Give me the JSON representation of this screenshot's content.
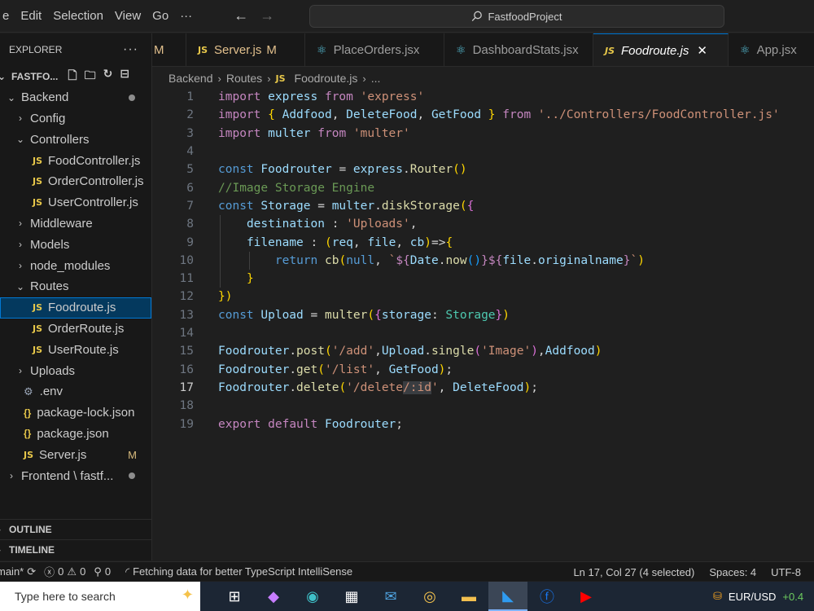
{
  "menu": {
    "items": [
      "e",
      "Edit",
      "Selection",
      "View",
      "Go",
      "···"
    ]
  },
  "nav": {
    "back": "←",
    "forward": "→"
  },
  "command_center": {
    "text": "FastfoodProject"
  },
  "explorer": {
    "title": "EXPLORER",
    "more": "···",
    "root": "FASTFO...",
    "tree": [
      {
        "label": "Backend",
        "chev": "⌄",
        "indent": 0,
        "dot": true
      },
      {
        "label": "Config",
        "chev": "›",
        "indent": 1
      },
      {
        "label": "Controllers",
        "chev": "⌄",
        "indent": 1
      },
      {
        "label": "FoodController.js",
        "badge": "JS",
        "indent": 2
      },
      {
        "label": "OrderController.js",
        "badge": "JS",
        "indent": 2
      },
      {
        "label": "UserController.js",
        "badge": "JS",
        "indent": 2
      },
      {
        "label": "Middleware",
        "chev": "›",
        "indent": 1
      },
      {
        "label": "Models",
        "chev": "›",
        "indent": 1
      },
      {
        "label": "node_modules",
        "chev": "›",
        "indent": 1
      },
      {
        "label": "Routes",
        "chev": "⌄",
        "indent": 1
      },
      {
        "label": "Foodroute.js",
        "badge": "JS",
        "indent": 2,
        "active": true
      },
      {
        "label": "OrderRoute.js",
        "badge": "JS",
        "indent": 2
      },
      {
        "label": "UserRoute.js",
        "badge": "JS",
        "indent": 2
      },
      {
        "label": "Uploads",
        "chev": "›",
        "indent": 1
      },
      {
        "label": ".env",
        "badge": "⚙",
        "indent": 1
      },
      {
        "label": "package-lock.json",
        "badge": "{}",
        "indent": 1
      },
      {
        "label": "package.json",
        "badge": "{}",
        "indent": 1
      },
      {
        "label": "Server.js",
        "badge": "JS",
        "indent": 1,
        "mod": "M"
      },
      {
        "label": "Frontend \\ fastf...",
        "chev": "›",
        "indent": 0,
        "dot": true
      }
    ],
    "outline": "OUTLINE",
    "timeline": "TIMELINE"
  },
  "tabs": [
    {
      "label": "M",
      "kind": "partial"
    },
    {
      "label": "Server.js",
      "badge": "JS",
      "mod": "M"
    },
    {
      "label": "PlaceOrders.jsx",
      "badge": "react"
    },
    {
      "label": "DashboardStats.jsx",
      "badge": "react"
    },
    {
      "label": "Foodroute.js",
      "badge": "JS",
      "active": true,
      "close": "✕"
    },
    {
      "label": "App.jsx",
      "badge": "react"
    }
  ],
  "breadcrumb": {
    "parts": [
      "Backend",
      "Routes",
      "Foodroute.js",
      "..."
    ],
    "sep": "›",
    "badge": "JS"
  },
  "editor": {
    "current_line": 17,
    "lines": [
      "import express from 'express'",
      "import { Addfood, DeleteFood, GetFood } from '../Controllers/FoodController.js'",
      "import multer from 'multer'",
      "",
      "const Foodrouter = express.Router()",
      "//Image Storage Engine",
      "const Storage = multer.diskStorage({",
      "    destination : 'Uploads',",
      "    filename : (req, file, cb)=>{",
      "        return cb(null, `${Date.now()}${file.originalname}`)",
      "    }",
      "})",
      "const Upload = multer({storage: Storage})",
      "",
      "Foodrouter.post('/add',Upload.single('Image'),Addfood)",
      "Foodrouter.get('/list', GetFood);",
      "Foodrouter.delete('/delete/:id', DeleteFood);",
      "",
      "export default Foodrouter;"
    ]
  },
  "statusbar": {
    "branch": "main*",
    "sync_icon": "⟳",
    "errors": "0",
    "warnings": "0",
    "ports": "0",
    "message": "Fetching data for better TypeScript IntelliSense",
    "cursor": "Ln 17, Col 27 (4 selected)",
    "spaces": "Spaces: 4",
    "encoding": "UTF-8"
  },
  "taskbar": {
    "search_placeholder": "Type here to search",
    "ticker": "EUR/USD",
    "ticker_change": "+0.4"
  },
  "colors": {
    "accent": "#0078d4",
    "js_badge": "#e8c84a",
    "react": "#58c4dc",
    "keyword": "#569cd6",
    "import_keyword": "#c586c0",
    "string": "#ce9178"
  }
}
